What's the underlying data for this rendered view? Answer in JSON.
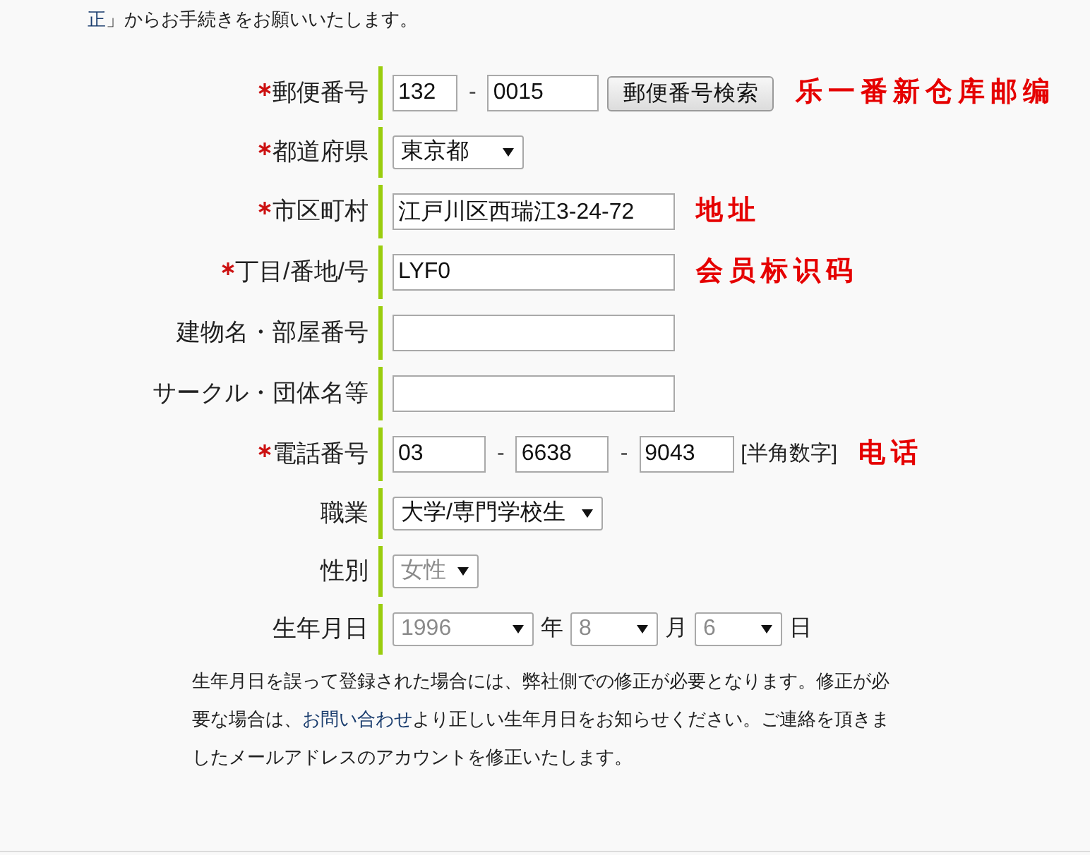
{
  "intro": {
    "link": "正",
    "text": "」からお手続きをお願いいたします。"
  },
  "form": {
    "rows": [
      {
        "label": "郵便番号",
        "required": true,
        "controls": [
          {
            "kind": "input",
            "value": "132"
          },
          {
            "kind": "dash",
            "text": "-"
          },
          {
            "kind": "input",
            "value": "0015"
          },
          {
            "kind": "button",
            "label": "郵便番号検索"
          }
        ],
        "annotation": "乐一番新仓库邮编"
      },
      {
        "label": "都道府県",
        "required": true,
        "controls": [
          {
            "kind": "select",
            "value": "東京都",
            "disabled": false
          }
        ]
      },
      {
        "label": "市区町村",
        "required": true,
        "controls": [
          {
            "kind": "input",
            "value": "江戸川区西瑞江3-24-72"
          }
        ],
        "annotation": "地址"
      },
      {
        "label": "丁目/番地/号",
        "required": true,
        "controls": [
          {
            "kind": "input",
            "value": "LYF0"
          }
        ],
        "annotation": "会员标识码"
      },
      {
        "label": "建物名・部屋番号",
        "required": false,
        "controls": [
          {
            "kind": "input"
          }
        ]
      },
      {
        "label": "サークル・団体名等",
        "required": false,
        "controls": [
          {
            "kind": "input"
          }
        ]
      },
      {
        "label": "電話番号",
        "required": true,
        "controls": [
          {
            "kind": "input",
            "value": "03"
          },
          {
            "kind": "dash",
            "text": "-"
          },
          {
            "kind": "input",
            "value": "6638"
          },
          {
            "kind": "dash",
            "text": "-"
          },
          {
            "kind": "input",
            "value": "9043"
          },
          {
            "kind": "hint",
            "text": "[半角数字]"
          }
        ],
        "annotation": "电话"
      },
      {
        "label": "職業",
        "required": false,
        "controls": [
          {
            "kind": "select",
            "value": "大学/専門学校生",
            "disabled": false
          }
        ]
      },
      {
        "label": "性別",
        "required": false,
        "controls": [
          {
            "kind": "select",
            "value": "女性",
            "disabled": true
          }
        ]
      },
      {
        "label": "生年月日",
        "required": false,
        "controls": [
          {
            "kind": "select",
            "value": "1996",
            "disabled": true
          },
          {
            "kind": "unit",
            "text": "年"
          },
          {
            "kind": "select",
            "value": "8",
            "disabled": true
          },
          {
            "kind": "unit",
            "text": "月"
          },
          {
            "kind": "select",
            "value": "6",
            "disabled": true
          },
          {
            "kind": "unit",
            "text": "日"
          }
        ]
      }
    ]
  },
  "note": {
    "before": "生年月日を誤って登録された場合には、弊社側での修正が必要となります。修正が必要な場合は、",
    "link": "お問い合わせ",
    "after": "より正しい生年月日をお知らせください。ご連絡を頂きましたメールアドレスのアカウントを修正いたします。"
  }
}
